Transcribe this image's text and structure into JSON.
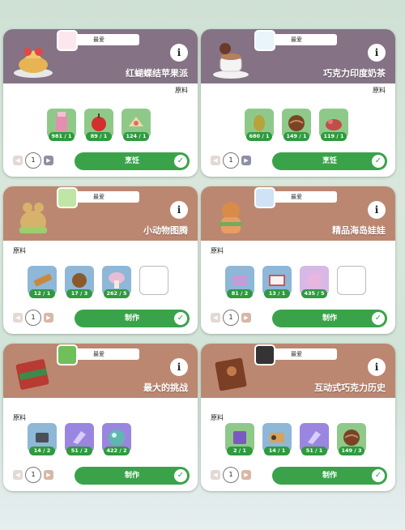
{
  "cards": [
    {
      "fav": "最爱",
      "title": "红蝴蝶结苹果派",
      "materials_label": "原料",
      "ingredients": [
        {
          "count": "981 / 1"
        },
        {
          "count": "89 / 1"
        },
        {
          "count": "124 / 1"
        }
      ],
      "quantity": "1",
      "action": "烹饪"
    },
    {
      "fav": "最爱",
      "title": "巧克力印度奶茶",
      "materials_label": "原料",
      "ingredients": [
        {
          "count": "680 / 1"
        },
        {
          "count": "149 / 1"
        },
        {
          "count": "119 / 1"
        }
      ],
      "quantity": "1",
      "action": "烹饪"
    },
    {
      "fav": "最爱",
      "title": "小动物图腾",
      "materials_label": "原料",
      "ingredients": [
        {
          "count": "12 / 1"
        },
        {
          "count": "17 / 3"
        },
        {
          "count": "262 / 5"
        }
      ],
      "quantity": "1",
      "action": "制作"
    },
    {
      "fav": "最爱",
      "title": "精品海岛娃娃",
      "materials_label": "原料",
      "ingredients": [
        {
          "count": "81 / 2"
        },
        {
          "count": "13 / 1"
        },
        {
          "count": "435 / 5"
        }
      ],
      "quantity": "1",
      "action": "制作"
    },
    {
      "fav": "最爱",
      "title": "最大的挑战",
      "materials_label": "原料",
      "ingredients": [
        {
          "count": "14 / 2"
        },
        {
          "count": "51 / 2"
        },
        {
          "count": "422 / 2"
        }
      ],
      "quantity": "1",
      "action": "制作"
    },
    {
      "fav": "最爱",
      "title": "互动式巧克力历史",
      "materials_label": "原料",
      "ingredients": [
        {
          "count": "2 / 1"
        },
        {
          "count": "14 / 1"
        },
        {
          "count": "51 / 1"
        },
        {
          "count": "149 / 3"
        }
      ],
      "quantity": "1",
      "action": "制作"
    }
  ],
  "colors": {
    "header_purple": "#857385",
    "header_brown": "#bc8771",
    "button_green": "#3aa34a",
    "count_green": "#2f9a3f"
  },
  "icons": {
    "info": "i",
    "check": "✓",
    "left": "◀",
    "right": "▶"
  }
}
